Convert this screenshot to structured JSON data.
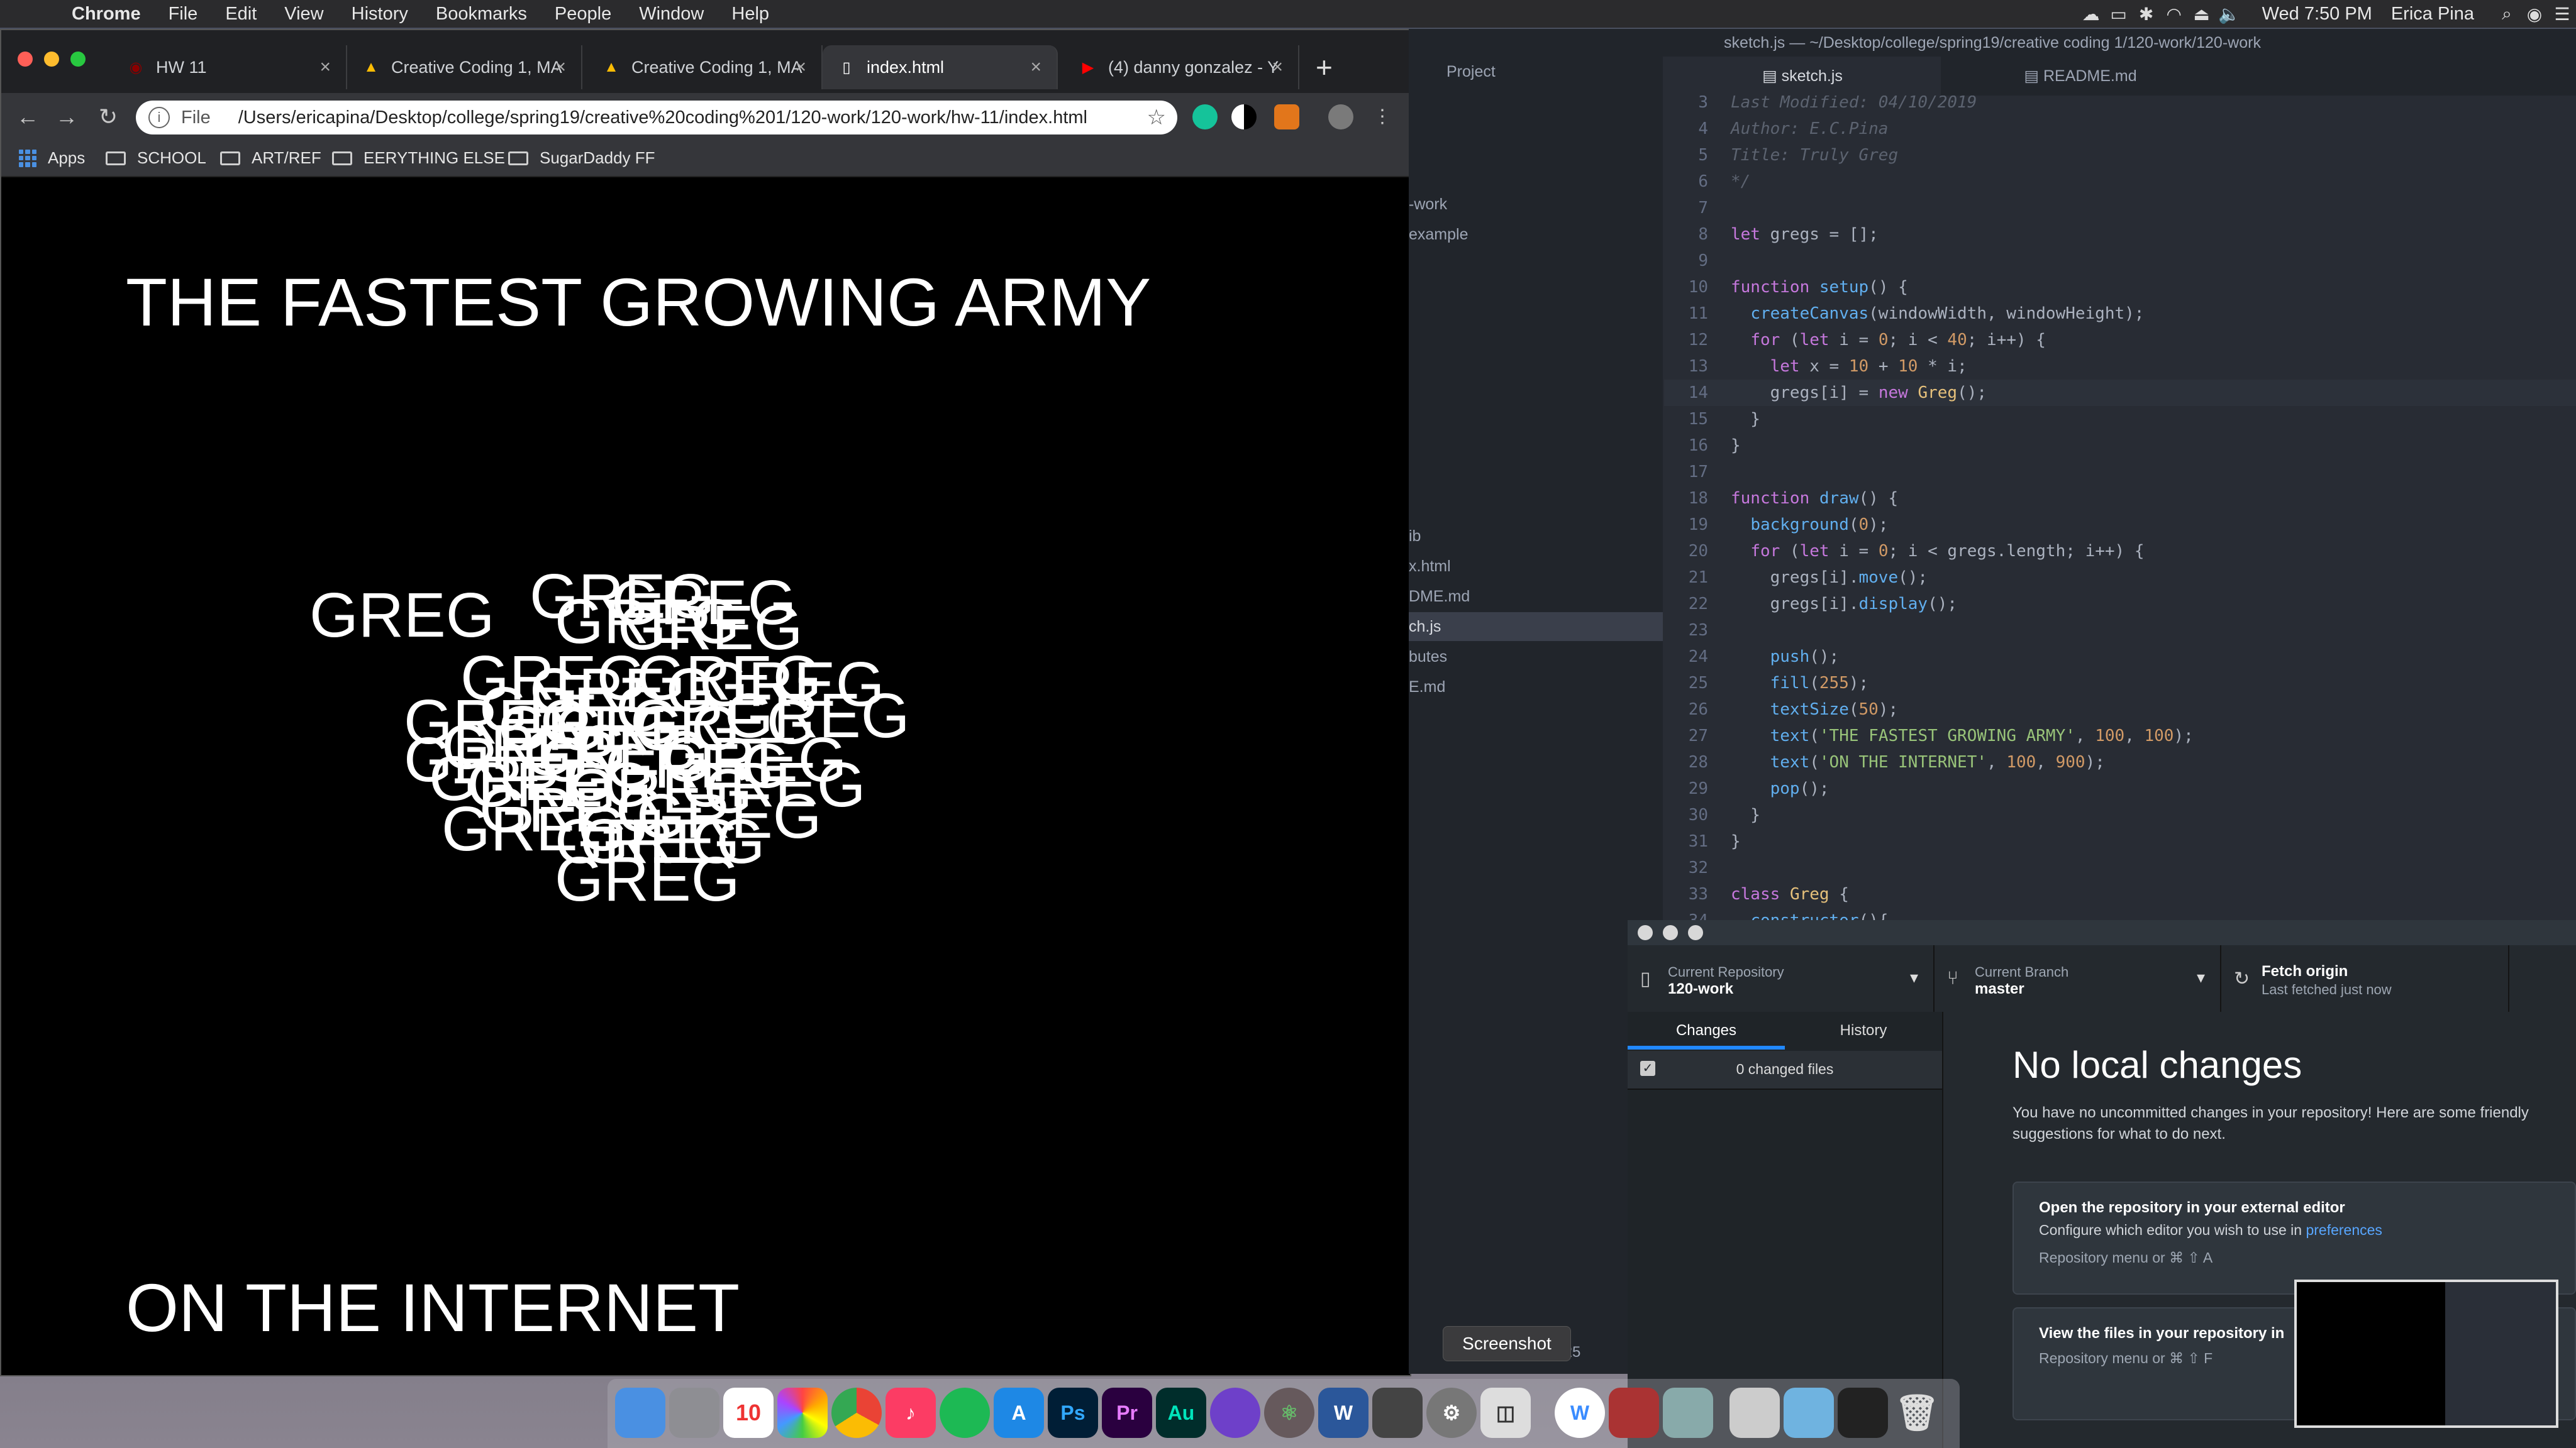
{
  "menubar": {
    "app": "Chrome",
    "items": [
      "File",
      "Edit",
      "View",
      "History",
      "Bookmarks",
      "People",
      "Window",
      "Help"
    ],
    "clock": "Wed 7:50 PM",
    "user": "Erica Pina"
  },
  "chrome": {
    "tabs": [
      {
        "label": "HW 11"
      },
      {
        "label": "Creative Coding 1, MA"
      },
      {
        "label": "Creative Coding 1, MA"
      },
      {
        "label": "index.html"
      },
      {
        "label": "(4) danny gonzalez - Y"
      }
    ],
    "omnibox": {
      "scheme": "File",
      "url": "/Users/ericapina/Desktop/college/spring19/creative%20coding%201/120-work/120-work/hw-11/index.html"
    },
    "bookmarks": [
      "Apps",
      "SCHOOL",
      "ART/REF",
      "EERYTHING ELSE",
      "SugarDaddy FF"
    ],
    "page": {
      "headline": "THE FASTEST GROWING ARMY",
      "footer": "ON THE INTERNET",
      "word": "GREG"
    }
  },
  "atom": {
    "title": "sketch.js — ~/Desktop/college/spring19/creative coding 1/120-work/120-work",
    "tree_header": "Project",
    "tree_items": [
      "-work",
      "example",
      "ib",
      "x.html",
      "DME.md",
      "ch.js",
      "butes",
      "E.md"
    ],
    "tabs": [
      "sketch.js",
      "README.md"
    ]
  },
  "github": {
    "repo_label": "Current Repository",
    "repo_value": "120-work",
    "branch_label": "Current Branch",
    "branch_value": "master",
    "fetch_title": "Fetch origin",
    "fetch_sub": "Last fetched just now",
    "tab_changes": "Changes",
    "tab_history": "History",
    "changed_files": "0 changed files",
    "heading": "No local changes",
    "desc": "You have no uncommitted changes in your repository! Here are some friendly suggestions for what to do next.",
    "card1_title": "Open the repository in your external editor",
    "card1_desc_pre": "Configure which editor you wish to use in",
    "card1_link": "preferences",
    "card1_shortcut": "Repository menu or  ⌘  ⇧  A",
    "card2_title": "View the files in your repository in",
    "card2_shortcut": "Repository menu or  ⌘  ⇧  F"
  },
  "tooltip": "Screenshot",
  "dock_badge": "10",
  "time_fragment": ":25"
}
